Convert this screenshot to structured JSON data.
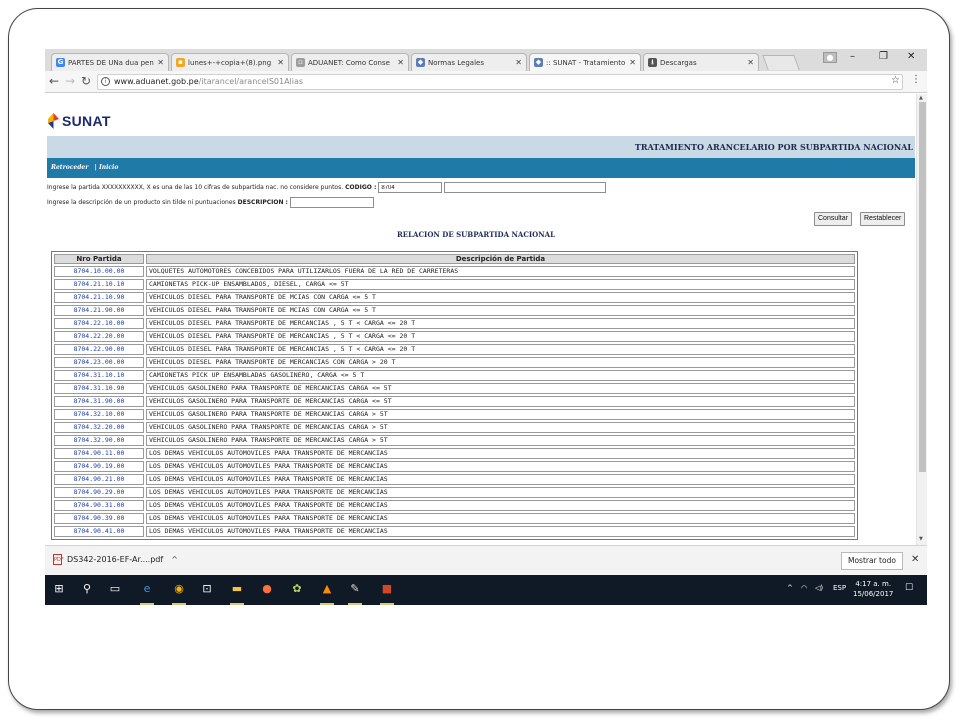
{
  "browser": {
    "tabs": [
      {
        "label": "PARTES DE UNa dua pen",
        "icon": "G",
        "color": "#4285f4",
        "active": false
      },
      {
        "label": "lunes+-+copia+(8).png",
        "icon": "▪",
        "color": "#f5a623",
        "active": false
      },
      {
        "label": "ADUANET: Como Conse",
        "icon": "▫",
        "color": "#9e9e9e",
        "active": false
      },
      {
        "label": "Normas Legales",
        "icon": "◆",
        "color": "#5c7cb8",
        "active": false
      },
      {
        "label": ":: SUNAT - Tratamiento",
        "icon": "◆",
        "color": "#5c7cb8",
        "active": true
      },
      {
        "label": "Descargas",
        "icon": "⭳",
        "color": "#555555",
        "active": false
      }
    ],
    "url_host": "www.aduanet.gob.pe",
    "url_path": "/itarancel/arancelS01Alias"
  },
  "page": {
    "logo_text": "SUNAT",
    "title": "TRATAMIENTO ARANCELARIO POR SUBPARTIDA NACIONAL",
    "nav_back": "Retroceder",
    "nav_sep": "|",
    "nav_home": "Inicio",
    "codigo_prompt": "Ingrese la partida XXXXXXXXXX, X es una de las 10 cifras de subpartida nac. no considere puntos.",
    "codigo_label": "CODIGO :",
    "codigo_value": "8704",
    "codigo_extra": "",
    "desc_prompt": "Ingrese la descripción de un producto sin tilde ni puntuaciones",
    "desc_label": "DESCRIPCION :",
    "desc_value": "",
    "btn_consultar": "Consultar",
    "btn_restablecer": "Restablecer",
    "relacion_title": "RELACION DE SUBPARTIDA NACIONAL",
    "table": {
      "headers": [
        "Nro Partida",
        "Descripción de Partida"
      ],
      "rows": [
        [
          "8704.10.00.00",
          "VOLQUETES AUTOMOTORES CONCEBIDOS PARA UTILIZARLOS FUERA DE LA RED DE CARRETERAS"
        ],
        [
          "8704.21.10.10",
          "CAMIONETAS PICK-UP ENSAMBLADOS, DIESEL, CARGA <= 5T"
        ],
        [
          "8704.21.10.90",
          "VEHICULOS DIESEL PARA TRANSPORTE DE MCIAS CON CARGA <= 5 T"
        ],
        [
          "8704.21.90.00",
          "VEHICULOS DIESEL PARA TRANSPORTE DE MCIAS CON CARGA <= 5 T"
        ],
        [
          "8704.22.10.00",
          "VEHICULOS DIESEL PARA TRANSPORTE DE MERCANCIAS , 5 T < CARGA <= 20 T"
        ],
        [
          "8704.22.20.00",
          "VEHICULOS DIESEL PARA TRANSPORTE DE MERCANCIAS , 5 T < CARGA <= 20 T"
        ],
        [
          "8704.22.90.00",
          "VEHICULOS DIESEL PARA TRANSPORTE DE MERCANCIAS , 5 T < CARGA <= 20 T"
        ],
        [
          "8704.23.00.00",
          "VEHICULOS DIESEL PARA TRANSPORTE DE MERCANCIAS CON CARGA > 20 T"
        ],
        [
          "8704.31.10.10",
          "CAMIONETAS PICK UP ENSAMBLADAS GASOLINERO, CARGA <= 5 T"
        ],
        [
          "8704.31.10.90",
          "VEHICULOS GASOLINERO PARA TRANSPORTE DE MERCANCIAS CARGA <= 5T"
        ],
        [
          "8704.31.90.00",
          "VEHICULOS GASOLINERO PARA TRANSPORTE DE MERCANCIAS CARGA <= 5T"
        ],
        [
          "8704.32.10.00",
          "VEHICULOS GASOLINERO PARA TRANSPORTE DE MERCANCIAS CARGA > 5T"
        ],
        [
          "8704.32.20.00",
          "VEHICULOS GASOLINERO PARA TRANSPORTE DE MERCANCIAS CARGA > 5T"
        ],
        [
          "8704.32.90.00",
          "VEHICULOS GASOLINERO PARA TRANSPORTE DE MERCANCIAS CARGA > 5T"
        ],
        [
          "8704.90.11.00",
          "LOS DEMAS VEHICULOS AUTOMOVILES PARA TRANSPORTE DE MERCANCIAS"
        ],
        [
          "8704.90.19.00",
          "LOS DEMAS VEHICULOS AUTOMOVILES PARA TRANSPORTE DE MERCANCIAS"
        ],
        [
          "8704.90.21.00",
          "LOS DEMAS VEHICULOS AUTOMOVILES PARA TRANSPORTE DE MERCANCIAS"
        ],
        [
          "8704.90.29.00",
          "LOS DEMAS VEHICULOS AUTOMOVILES PARA TRANSPORTE DE MERCANCIAS"
        ],
        [
          "8704.90.31.00",
          "LOS DEMAS VEHICULOS AUTOMOVILES PARA TRANSPORTE DE MERCANCIAS"
        ],
        [
          "8704.90.39.00",
          "LOS DEMAS VEHICULOS AUTOMOVILES PARA TRANSPORTE DE MERCANCIAS"
        ],
        [
          "8704.90.41.00",
          "LOS DEMAS VEHICULOS AUTOMOVILES PARA TRANSPORTE DE MERCANCIAS"
        ]
      ]
    }
  },
  "downloads": {
    "file_name": "DS342-2016-EF-Ar....pdf",
    "show_all": "Mostrar todo"
  },
  "taskbar": {
    "language": "ESP",
    "time": "4:17 a. m.",
    "date": "15/06/2017"
  },
  "colors": {
    "title_band": "#c9d9e6",
    "nav_band": "#1f7aa8",
    "link": "#1a3ea8",
    "brand": "#1a2a6e"
  }
}
